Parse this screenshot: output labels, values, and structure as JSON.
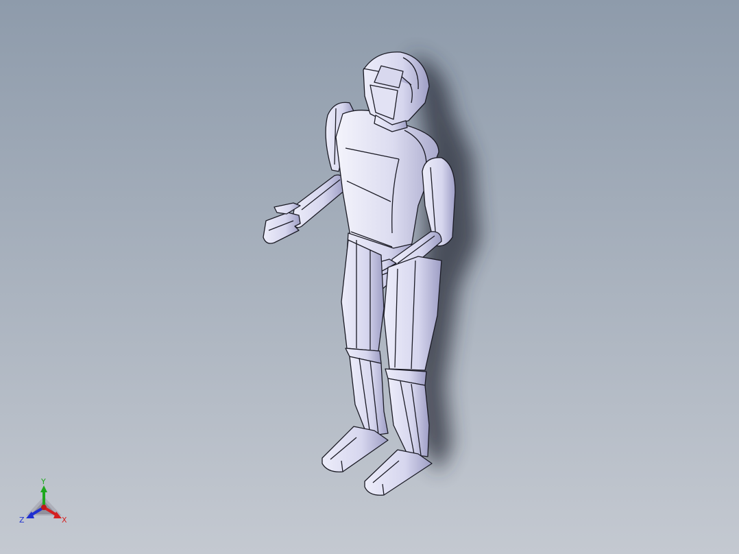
{
  "viewport": {
    "background_top": "#8e9bab",
    "background_bottom": "#c4c9d1"
  },
  "model": {
    "name": "humanoid-robot",
    "face_color": "#e6e6f7",
    "shade_color": "#b9b9d8",
    "edge_color": "#1a1a24"
  },
  "triad": {
    "x_label": "X",
    "y_label": "Y",
    "z_label": "Z",
    "x_color": "#d42020",
    "y_color": "#1ea81e",
    "z_color": "#2030d0"
  }
}
